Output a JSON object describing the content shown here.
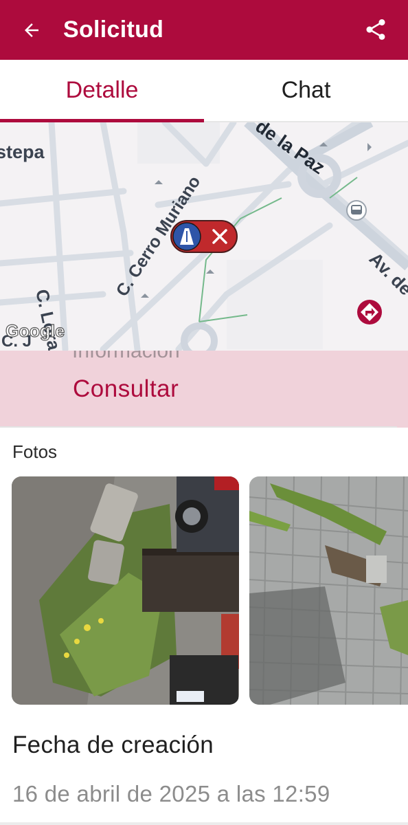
{
  "appbar": {
    "title": "Solicitud",
    "back_icon": "arrow-left-icon",
    "share_icon": "share-icon"
  },
  "tabs": [
    {
      "label": "Detalle",
      "active": true
    },
    {
      "label": "Chat",
      "active": false
    }
  ],
  "map": {
    "labels": {
      "street_1": "stepa",
      "street_2": "C. Lora del Río",
      "street_3": "C. Cerro Muriano",
      "street_4": "de la Paz",
      "street_5": "Av. de",
      "street_6": "C. J"
    },
    "watermark": "Google",
    "marker_icon": "road-icon",
    "marker_status_icon": "close-icon",
    "directions_icon": "directions-icon",
    "bus_icon": "bus-stop-icon"
  },
  "consult": {
    "ghost_text": "Información",
    "button_label": "Consultar"
  },
  "photos": {
    "label": "Fotos",
    "items": [
      {
        "name": "photo-1"
      },
      {
        "name": "photo-2"
      }
    ]
  },
  "fecha": {
    "title": "Fecha de creación",
    "value": "16 de abril de 2025 a las 12:59"
  },
  "colors": {
    "brand": "#ad0b3d",
    "consult_bg": "#f0d2da",
    "map_bg": "#f4f2f4"
  }
}
